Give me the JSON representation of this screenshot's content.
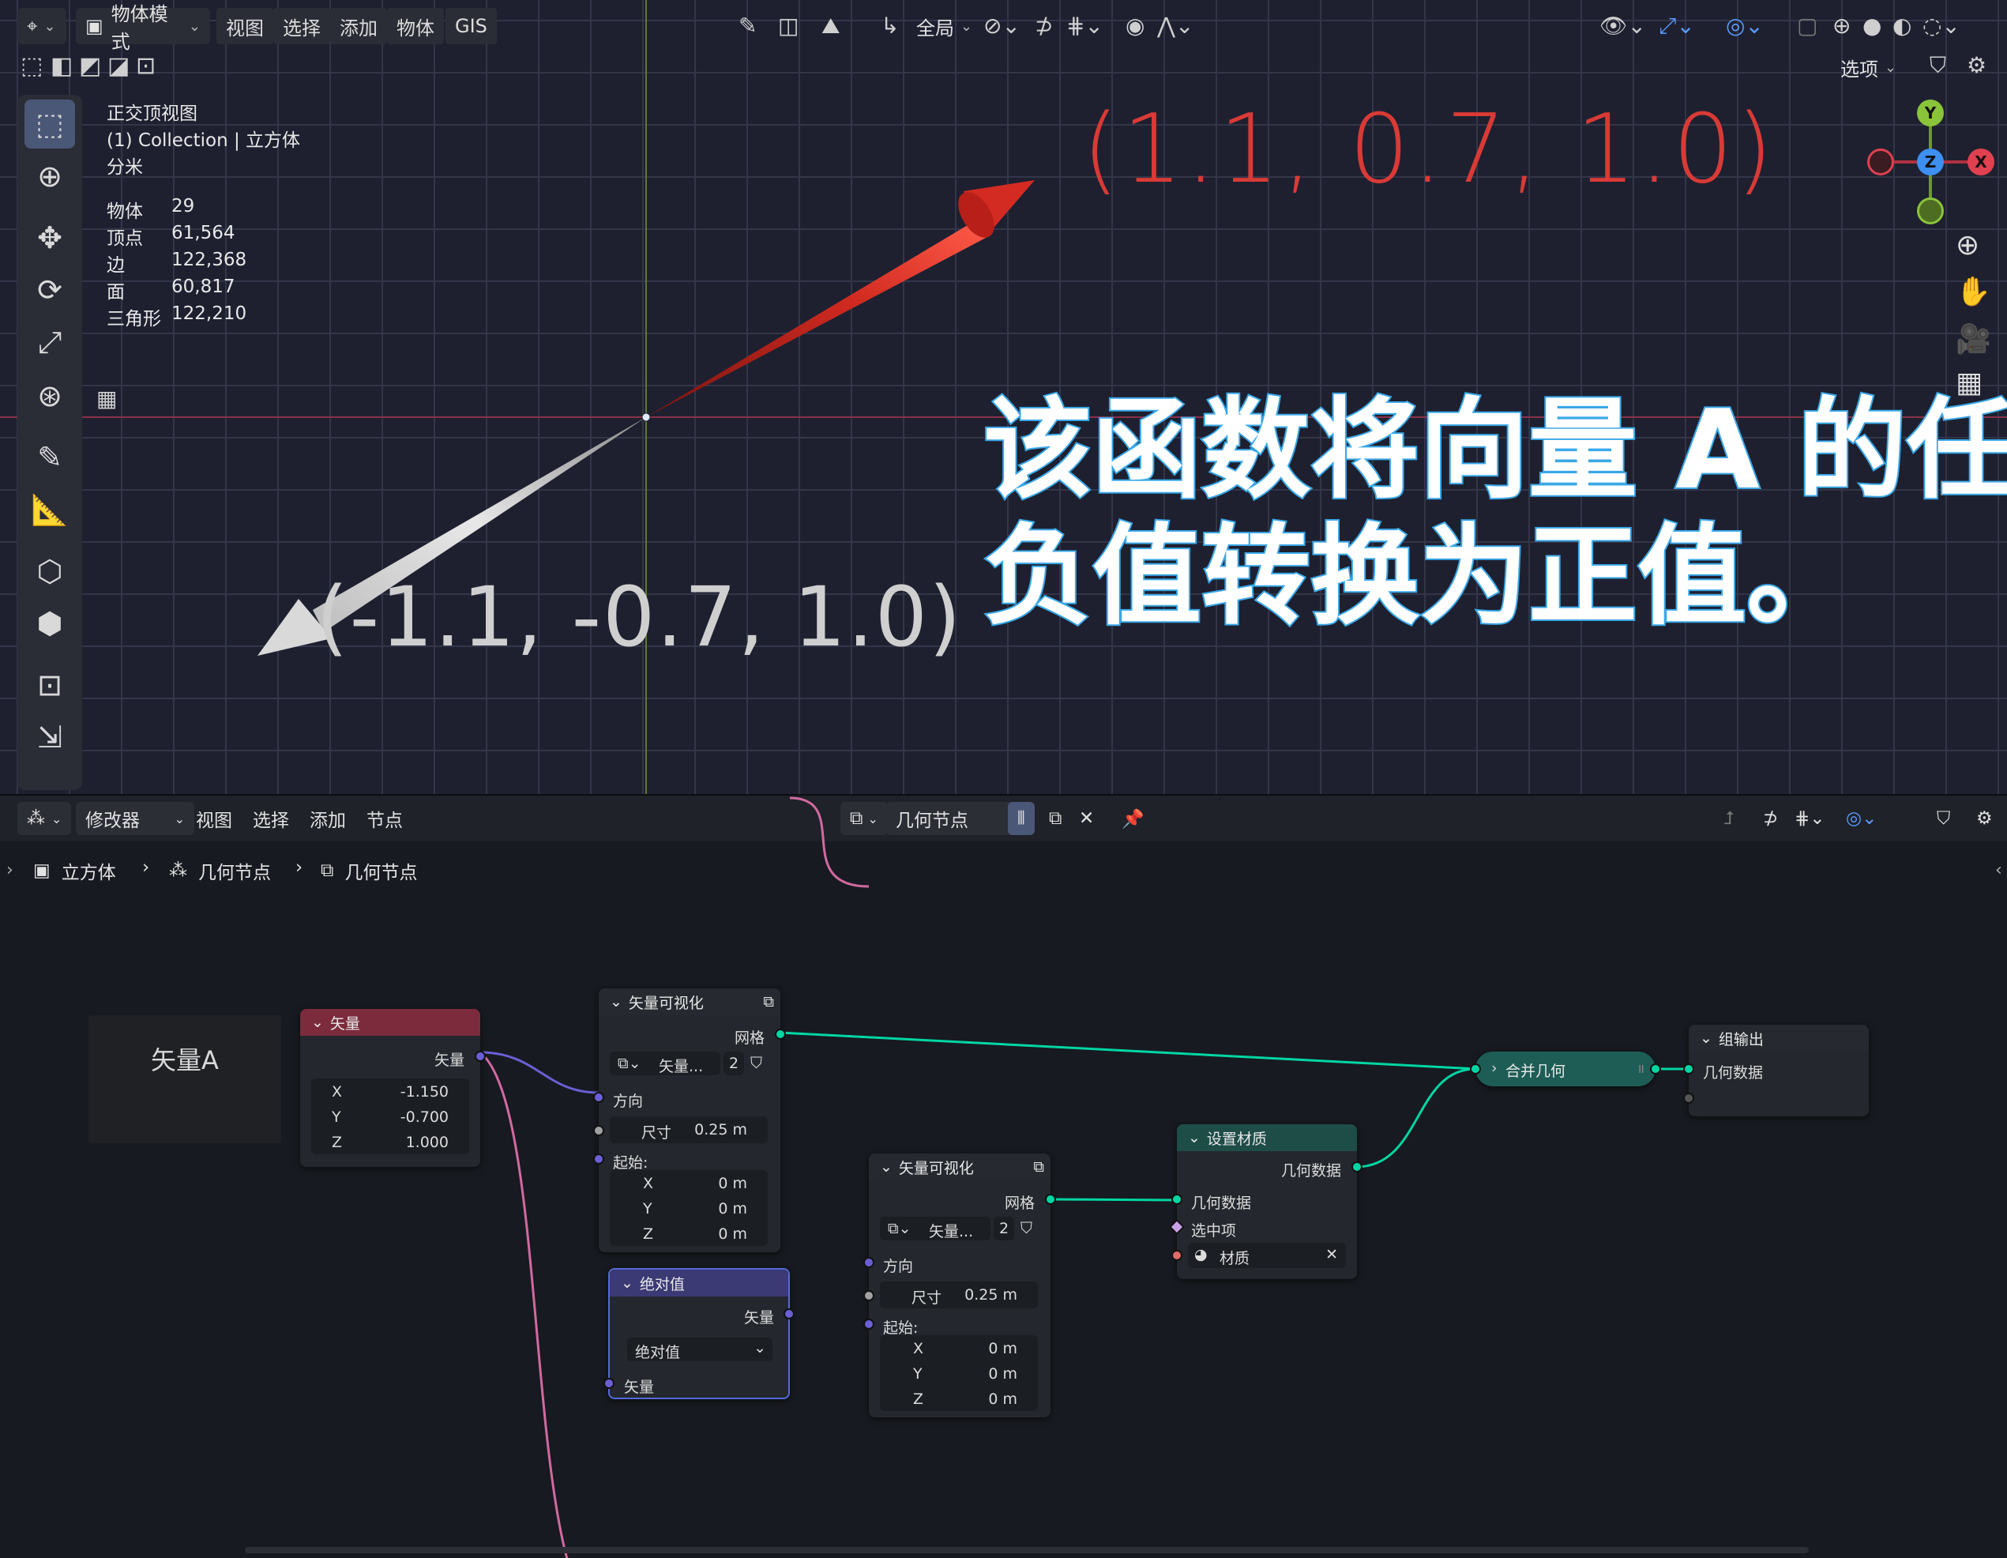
{
  "viewport": {
    "header": {
      "mode": "物体模式",
      "menus": [
        "视图",
        "选择",
        "添加",
        "物体",
        "GIS"
      ],
      "transform_space": "全局",
      "options": "选项"
    },
    "overlay": {
      "view_name": "正交顶视图",
      "collection": "(1) Collection | 立方体",
      "unit": "分米",
      "stats": [
        {
          "label": "物体",
          "value": "29"
        },
        {
          "label": "顶点",
          "value": "61,564"
        },
        {
          "label": "边",
          "value": "122,368"
        },
        {
          "label": "面",
          "value": "60,817"
        },
        {
          "label": "三角形",
          "value": "122,210"
        }
      ]
    },
    "vector_red_label": "(1.1, 0.7, 1.0)",
    "vector_grey_label": "(-1.1, -0.7, 1.0)",
    "caption_line1": "该函数将向量 A 的任何",
    "caption_line2": "负值转换为正值。",
    "gizmo": {
      "x": "X",
      "y": "Y",
      "z": "Z"
    },
    "colors": {
      "red_arrow": "#d32a22",
      "grey_arrow": "#cfcfcf",
      "caption_stroke": "#3aa8e8"
    }
  },
  "node_editor": {
    "header": {
      "editor_type": "修改器",
      "menus": [
        "视图",
        "选择",
        "添加",
        "节点"
      ],
      "tree_name": "几何节点"
    },
    "breadcrumb": [
      "立方体",
      "几何节点",
      "几何节点"
    ],
    "frame_label": "矢量A",
    "nodes": {
      "vector": {
        "title": "矢量",
        "output": "矢量",
        "x_label": "X",
        "x": "-1.150",
        "y_label": "Y",
        "y": "-0.700",
        "z_label": "Z",
        "z": "1.000"
      },
      "viz1": {
        "title": "矢量可视化",
        "output": "网格",
        "dropdown": "矢量...",
        "count": "2",
        "direction": "方向",
        "size_label": "尺寸",
        "size": "0.25 m",
        "start": "起始:",
        "x_label": "X",
        "x": "0 m",
        "y_label": "Y",
        "y": "0 m",
        "z_label": "Z",
        "z": "0 m"
      },
      "abs": {
        "title": "绝对值",
        "output": "矢量",
        "operation": "绝对值",
        "input": "矢量"
      },
      "viz2": {
        "title": "矢量可视化",
        "output": "网格",
        "dropdown": "矢量...",
        "count": "2",
        "direction": "方向",
        "size_label": "尺寸",
        "size": "0.25 m",
        "start": "起始:",
        "x_label": "X",
        "x": "0 m",
        "y_label": "Y",
        "y": "0 m",
        "z_label": "Z",
        "z": "0 m"
      },
      "set_material": {
        "title": "设置材质",
        "output": "几何数据",
        "input_geo": "几何数据",
        "selection": "选中项",
        "material": "材质"
      },
      "join": {
        "title": "合并几何"
      },
      "group_output": {
        "title": "组输出",
        "input": "几何数据"
      }
    },
    "colors": {
      "vector_header": "#7b2b3c",
      "viz_header": "#262a30",
      "abs_header": "#3c3a75",
      "material_header": "#1e4d48",
      "join_body": "#1d5d55",
      "geo_link": "#00d6a3",
      "vec_link": "#6a5fd6",
      "pink_link": "#d16aa0"
    }
  }
}
